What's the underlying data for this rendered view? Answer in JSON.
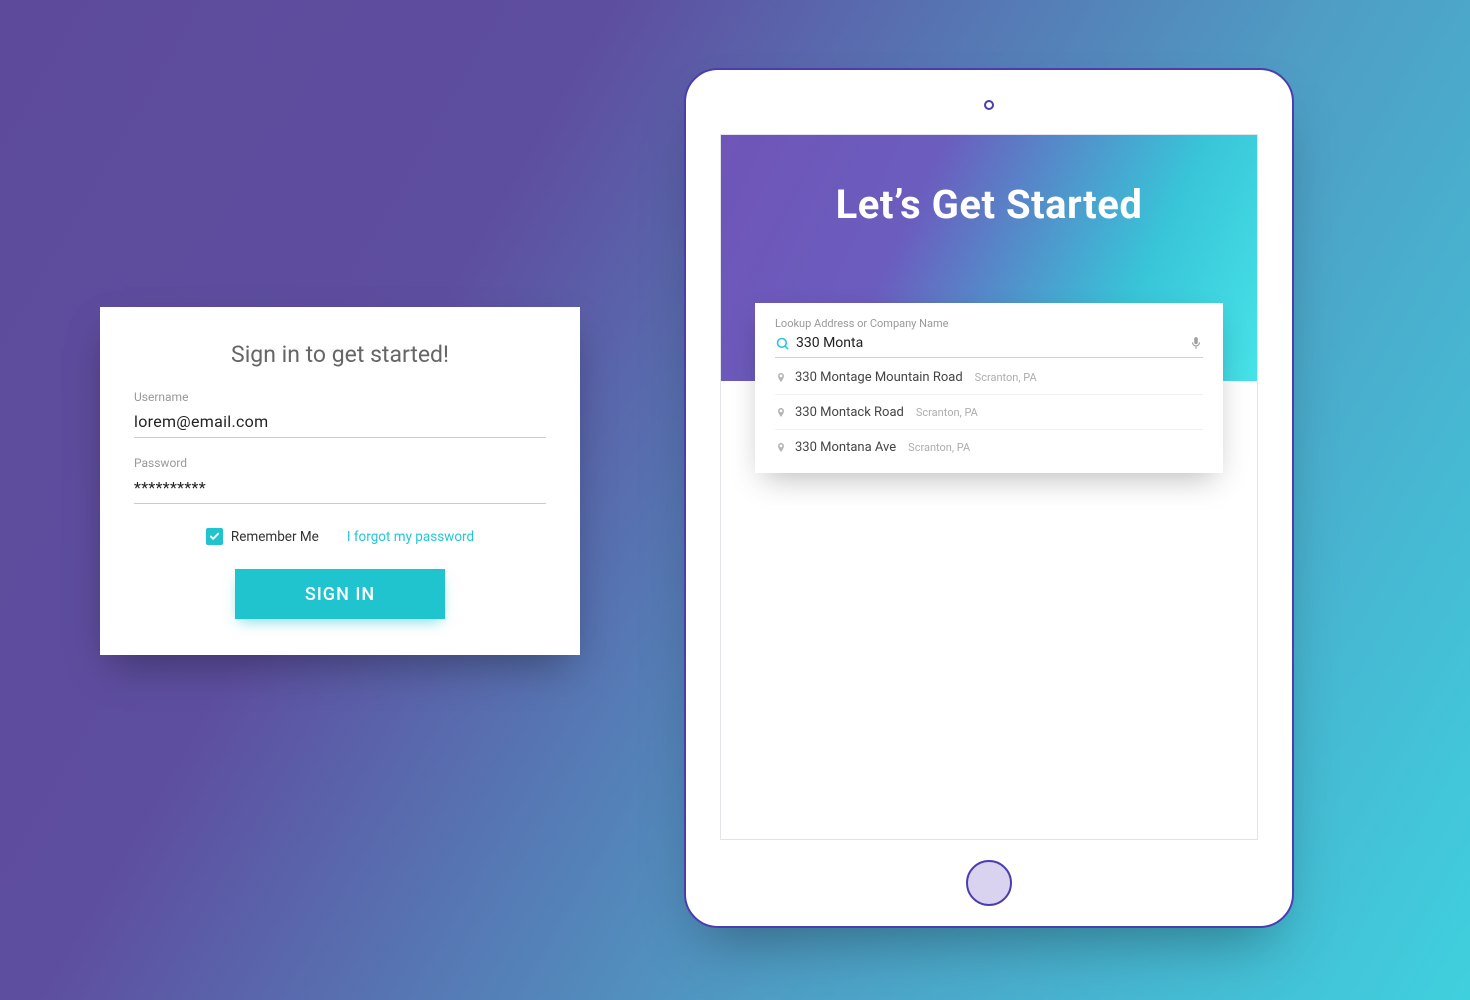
{
  "signin": {
    "title": "Sign in to get started!",
    "username_label": "Username",
    "username_value": "lorem@email.com",
    "password_label": "Password",
    "password_value": "**********",
    "remember_label": "Remember Me",
    "remember_checked": true,
    "forgot_label": "I forgot my password",
    "button_label": "SIGN IN"
  },
  "tablet": {
    "hero_title": "Let’s Get Started",
    "lookup": {
      "label": "Lookup Address or Company Name",
      "value": "330 Monta",
      "suggestions": [
        {
          "main": "330 Montage Mountain Road",
          "sub": "Scranton, PA"
        },
        {
          "main": "330 Montack Road",
          "sub": "Scranton, PA"
        },
        {
          "main": "330 Montana Ave",
          "sub": "Scranton, PA"
        }
      ]
    }
  },
  "colors": {
    "accent": "#1fc4cf",
    "primary": "#4a3db0"
  }
}
